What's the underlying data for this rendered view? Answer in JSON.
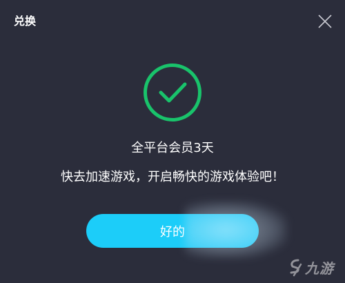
{
  "window": {
    "title": "兑换"
  },
  "icons": {
    "close": "close-icon",
    "success": "check-circle-icon"
  },
  "result": {
    "reward": "全平台会员3天",
    "message": "快去加速游戏，开启畅快的游戏体验吧！"
  },
  "actions": {
    "ok_label": "好的"
  },
  "watermark": {
    "text": "九游"
  },
  "colors": {
    "background": "#2b2d3b",
    "success_green": "#19c36b",
    "button_cyan": "#1ccdf9",
    "text": "#ffffff"
  }
}
